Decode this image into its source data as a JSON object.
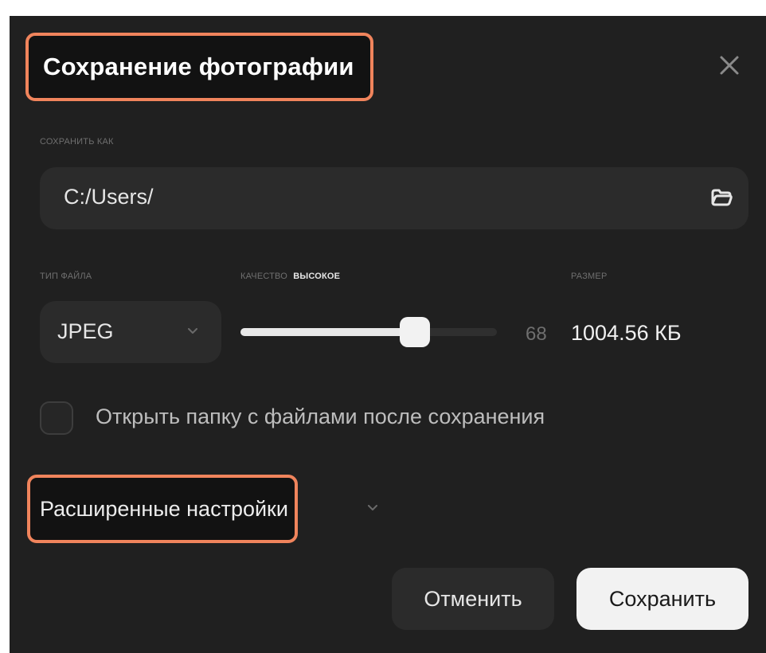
{
  "dialog": {
    "title": "Сохранение фотографии",
    "save_as_label": "Сохранить как",
    "path_value": "C:/Users/",
    "file_type_label": "Тип файла",
    "file_type_value": "JPEG",
    "quality_label": "Качество",
    "quality_level": "Высокое",
    "quality_value": "68",
    "quality_fraction": 0.68,
    "size_label": "Размер",
    "size_value": "1004.56 КБ",
    "open_folder_label": "Открыть папку с файлами после сохранения",
    "open_folder_checked": false,
    "advanced_label": "Расширенные настройки",
    "cancel_label": "Отменить",
    "save_label": "Сохранить"
  },
  "icons": {
    "close": "close-icon",
    "folder": "folder-icon",
    "chevron": "chevron-down-icon"
  },
  "colors": {
    "dialog_bg": "#202020",
    "field_bg": "#2b2b2b",
    "highlight": "#f0845c",
    "primary_button": "#f2f2f2"
  }
}
